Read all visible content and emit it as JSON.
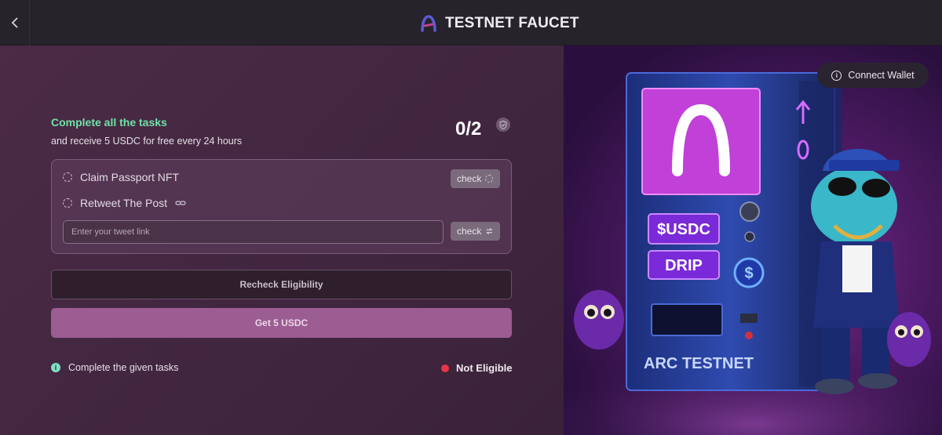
{
  "header": {
    "title": "TESTNET FAUCET",
    "back_icon": "chevron-left-icon",
    "logo_icon": "arc-logo-icon"
  },
  "tasks": {
    "title": "Complete all the tasks",
    "subtitle": "and receive 5 USDC for free every 24 hours",
    "progress": "0/2",
    "items": [
      {
        "label": "Claim Passport NFT",
        "check_label": "check"
      },
      {
        "label": "Retweet The Post",
        "check_label": "check"
      }
    ],
    "tweet_input": {
      "placeholder": "Enter your tweet link",
      "value": ""
    }
  },
  "actions": {
    "recheck_label": "Recheck Eligibility",
    "get_label": "Get 5 USDC"
  },
  "footer": {
    "info_text": "Complete the given tasks",
    "status_text": "Not Eligible"
  },
  "promo": {
    "connect_label": "Connect Wallet",
    "usdc_label": "$USDC",
    "drip_label": "DRIP",
    "machine_label": "ARC TESTNET"
  },
  "colors": {
    "accent_green": "#6fe3a7",
    "status_red": "#e8354a",
    "button_pink": "#9c5d93"
  }
}
